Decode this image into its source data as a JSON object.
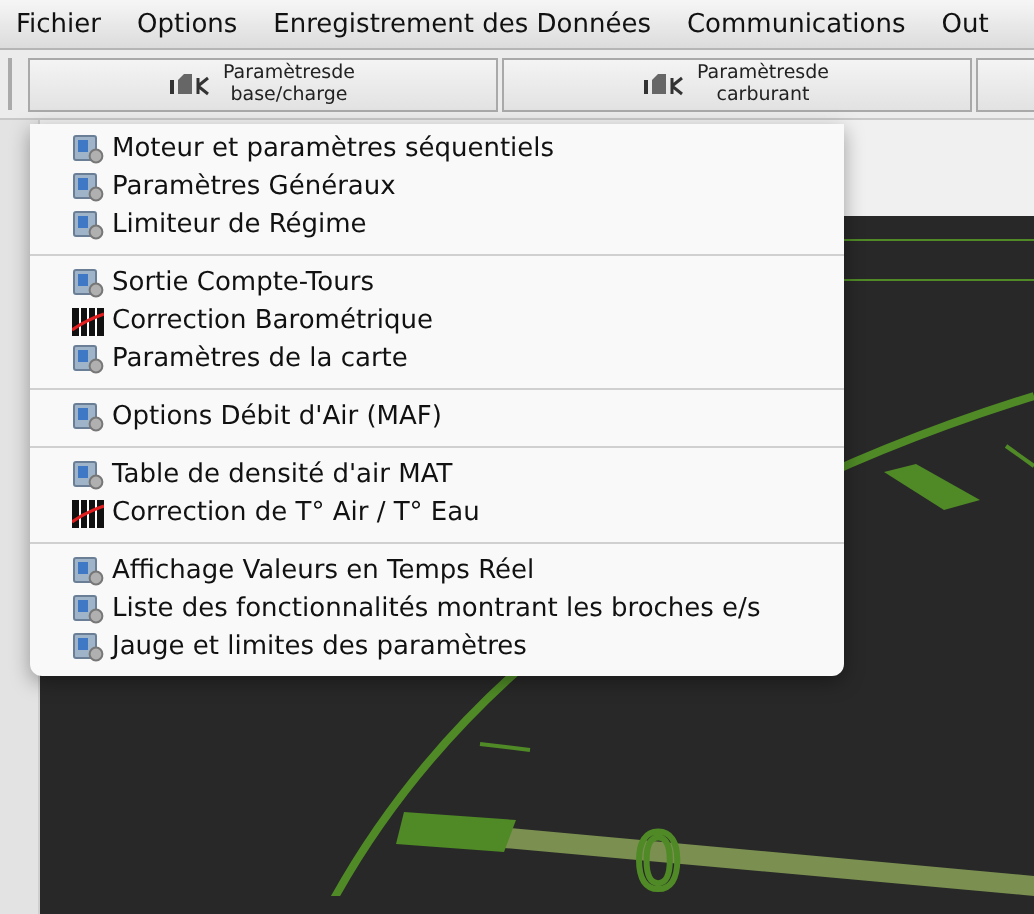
{
  "menubar": {
    "items": [
      "Fichier",
      "Options",
      "Enregistrement des Données",
      "Communications",
      "Out"
    ]
  },
  "toolbar": {
    "buttons": [
      {
        "lines": [
          "Paramètresde",
          "base/charge"
        ]
      },
      {
        "lines": [
          "Paramètresde",
          "carburant"
        ]
      }
    ]
  },
  "menu": {
    "sections": [
      [
        {
          "label": "Moteur et paramètres séquentiels",
          "kind": "app"
        },
        {
          "label": "Paramètres Généraux",
          "kind": "app"
        },
        {
          "label": "Limiteur de Régime",
          "kind": "app"
        }
      ],
      [
        {
          "label": "Sortie Compte-Tours",
          "kind": "app"
        },
        {
          "label": "Correction Barométrique",
          "kind": "table"
        },
        {
          "label": "Paramètres de la carte",
          "kind": "app"
        }
      ],
      [
        {
          "label": "Options Débit d'Air (MAF)",
          "kind": "app"
        }
      ],
      [
        {
          "label": "Table de densité d'air MAT",
          "kind": "app"
        },
        {
          "label": "Correction de T° Air / T° Eau",
          "kind": "table"
        }
      ],
      [
        {
          "label": "Affichage Valeurs en Temps Réel",
          "kind": "app"
        },
        {
          "label": "Liste des fonctionnalités montrant les broches e/s",
          "kind": "app"
        },
        {
          "label": "Jauge et limites des paramètres",
          "kind": "app"
        }
      ]
    ]
  },
  "gauge": {
    "label": "0"
  }
}
